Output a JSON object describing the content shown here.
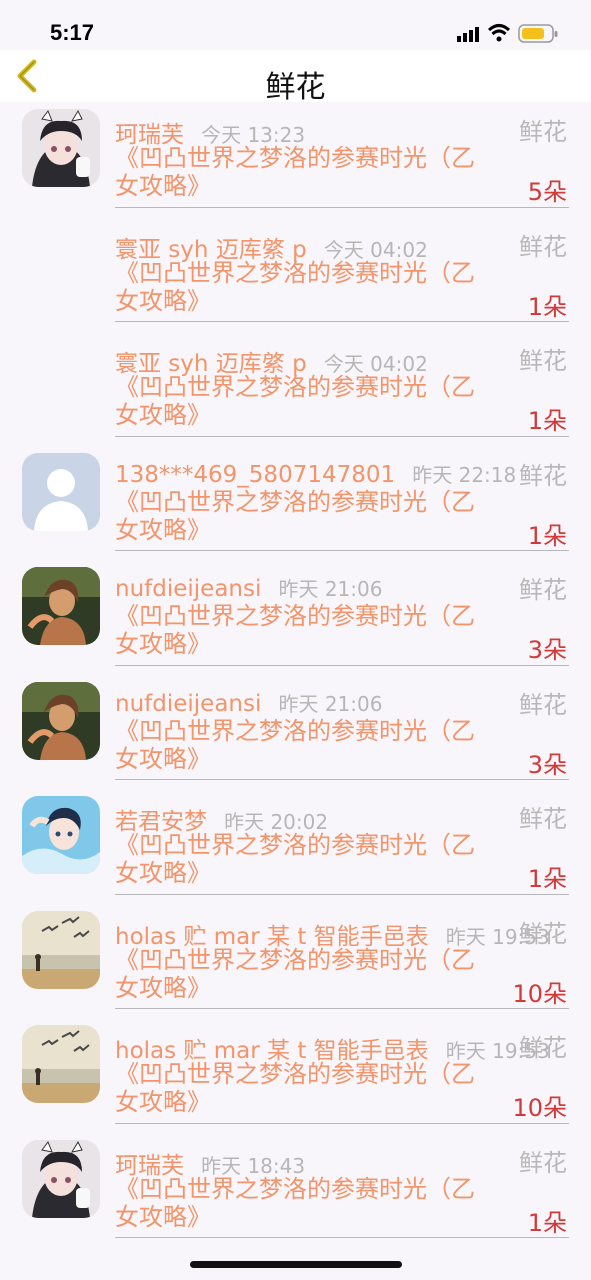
{
  "status_bar": {
    "time": "5:17"
  },
  "nav": {
    "title": "鲜花"
  },
  "items": [
    {
      "user": "珂瑞芙",
      "time": "今天 13:23",
      "type": "鲜花",
      "title": "《凹凸世界之梦洛的参赛时光（乙女攻略》",
      "count": "5朵",
      "avatar": "anime-girl-avatar"
    },
    {
      "user": "寰亚 syh 迈库綮 p",
      "time": "今天 04:02",
      "type": "鲜花",
      "title": "《凹凸世界之梦洛的参赛时光（乙女攻略》",
      "count": "1朵",
      "avatar": "none"
    },
    {
      "user": "寰亚 syh 迈库綮 p",
      "time": "今天 04:02",
      "type": "鲜花",
      "title": "《凹凸世界之梦洛的参赛时光（乙女攻略》",
      "count": "1朵",
      "avatar": "none"
    },
    {
      "user": "138***469_5807147801",
      "time": "昨天 22:18",
      "type": "鲜花",
      "title": "《凹凸世界之梦洛的参赛时光（乙女攻略》",
      "count": "1朵",
      "avatar": "default-person-avatar"
    },
    {
      "user": "nufdieijeansi",
      "time": "昨天 21:06",
      "type": "鲜花",
      "title": "《凹凸世界之梦洛的参赛时光（乙女攻略》",
      "count": "3朵",
      "avatar": "photo-girl-avatar"
    },
    {
      "user": "nufdieijeansi",
      "time": "昨天 21:06",
      "type": "鲜花",
      "title": "《凹凸世界之梦洛的参赛时光（乙女攻略》",
      "count": "3朵",
      "avatar": "photo-girl-avatar"
    },
    {
      "user": "若君安梦",
      "time": "昨天 20:02",
      "type": "鲜花",
      "title": "《凹凸世界之梦洛的参赛时光（乙女攻略》",
      "count": "1朵",
      "avatar": "anime-boy-avatar"
    },
    {
      "user": "holas 贮 mar 某 t 智能手邑表",
      "time": "昨天 19:53",
      "type": "鲜花",
      "title": "《凹凸世界之梦洛的参赛时光（乙女攻略》",
      "count": "10朵",
      "avatar": "beach-seagulls-avatar"
    },
    {
      "user": "holas 贮 mar 某 t 智能手邑表",
      "time": "昨天 19:53",
      "type": "鲜花",
      "title": "《凹凸世界之梦洛的参赛时光（乙女攻略》",
      "count": "10朵",
      "avatar": "beach-seagulls-avatar"
    },
    {
      "user": "珂瑞芙",
      "time": "昨天 18:43",
      "type": "鲜花",
      "title": "《凹凸世界之梦洛的参赛时光（乙女攻略》",
      "count": "1朵",
      "avatar": "anime-girl-avatar"
    }
  ]
}
